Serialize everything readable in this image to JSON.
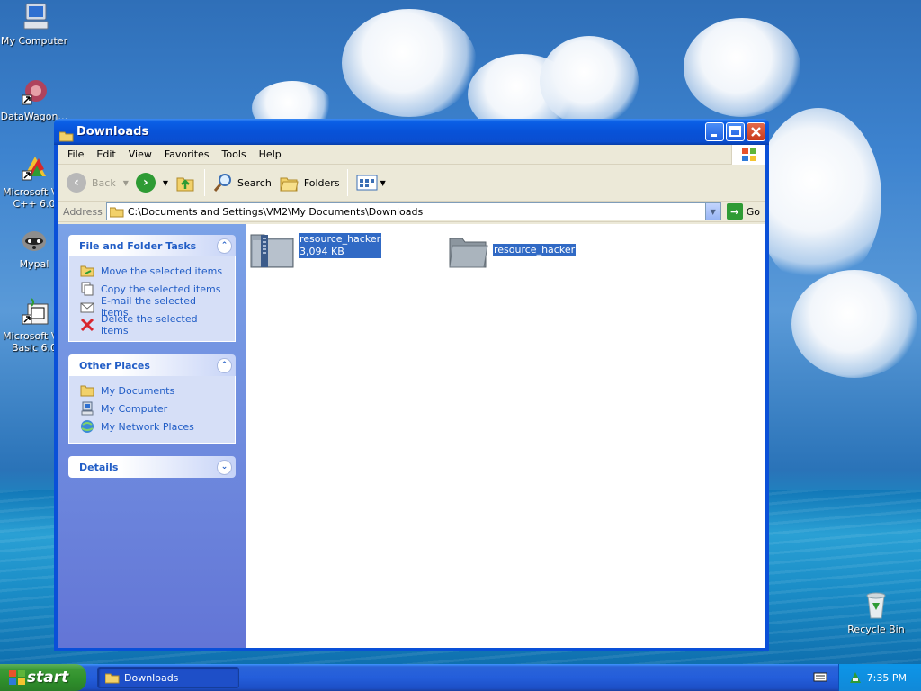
{
  "desktop": {
    "icons": [
      {
        "label": "My Computer",
        "icon": "my-computer-icon"
      },
      {
        "label": "DataWagon…",
        "icon": "datawagon-shortcut-icon"
      },
      {
        "label": "Microsoft Vis\nC++ 6.0",
        "icon": "visual-cpp-shortcut-icon"
      },
      {
        "label": "Mypal",
        "icon": "mypal-raccoon-icon"
      },
      {
        "label": "Microsoft Vis\nBasic 6.0",
        "icon": "visual-basic-shortcut-icon"
      },
      {
        "label": "Recycle Bin",
        "icon": "recycle-bin-icon"
      }
    ]
  },
  "window": {
    "title": "Downloads",
    "menu": [
      "File",
      "Edit",
      "View",
      "Favorites",
      "Tools",
      "Help"
    ],
    "toolbar": {
      "back": "Back",
      "search": "Search",
      "folders": "Folders"
    },
    "address": {
      "label": "Address",
      "value": "C:\\Documents and Settings\\VM2\\My Documents\\Downloads",
      "go": "Go"
    },
    "panels": {
      "tasks": {
        "title": "File and Folder Tasks",
        "items": [
          "Move the selected items",
          "Copy the selected items",
          "E-mail the selected items",
          "Delete the selected items"
        ]
      },
      "places": {
        "title": "Other Places",
        "items": [
          "My Documents",
          "My Computer",
          "My Network Places"
        ]
      },
      "details": {
        "title": "Details"
      }
    },
    "files": [
      {
        "name": "resource_hacker",
        "size": "3,094 KB",
        "type": "zip-folder-icon"
      },
      {
        "name": "resource_hacker",
        "type": "folder-icon"
      }
    ]
  },
  "taskbar": {
    "start": "start",
    "task": "Downloads",
    "time": "7:35 PM"
  },
  "colors": {
    "selection": "#316ac5",
    "link": "#215dc6",
    "titlebar": "#0a50d8"
  }
}
